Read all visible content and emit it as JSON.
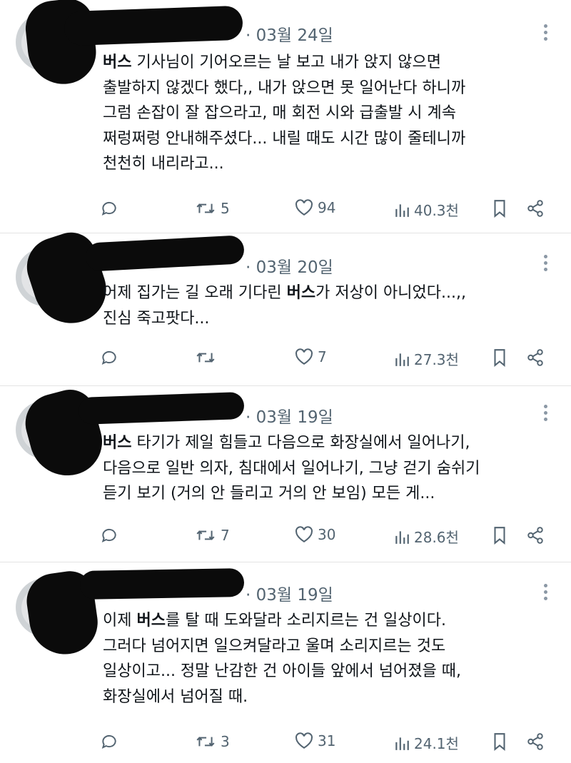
{
  "tweets": [
    {
      "date": "· 03월 24일",
      "line1_hl": "버스",
      "line1": " 기사님이 기어오르는 날 보고 내가 앉지 않으면",
      "line2": "출발하지 않겠다 했다,, 내가 앉으면 못 일어난다 하니까",
      "line3": "그럼 손잡이 잘 잡으라고, 매 회전 시와 급출발 시 계속",
      "line4": "쩌렁쩌렁 안내해주셨다... 내릴 때도 시간 많이 줄테니까",
      "line5": "천천히 내리라고...",
      "retweets": "5",
      "likes": "94",
      "views": "40.3천"
    },
    {
      "date": "· 03월 20일",
      "line1_pre": "어제 집가는 길 오래 기다린 ",
      "line1_hl": "버스",
      "line1_post": "가 저상이 아니었다...,,",
      "line2": "진심 죽고팟다...",
      "retweets": "",
      "likes": "7",
      "views": "27.3천"
    },
    {
      "date": "· 03월 19일",
      "line1_hl": "버스",
      "line1": " 타기가 제일 힘들고 다음으로 화장실에서 일어나기,",
      "line2": "다음으로 일반 의자, 침대에서 일어나기, 그냥 걷기 숨쉬기",
      "line3": "듣기 보기 (거의 안 들리고 거의 안 보임) 모든 게...",
      "retweets": "7",
      "likes": "30",
      "views": "28.6천"
    },
    {
      "date": "· 03월 19일",
      "line1_pre": "이제 ",
      "line1_hl": "버스",
      "line1_post": "를 탈 때 도와달라 소리지르는 건 일상이다.",
      "line2": "그러다 넘어지면 일으켜달라고 울며 소리지르는 것도",
      "line3": "일상이고... 정말 난감한 건 아이들 앞에서 넘어졌을 때,",
      "line4": "화장실에서 넘어질 때.",
      "retweets": "3",
      "likes": "31",
      "views": "24.1천"
    }
  ],
  "icons": {
    "reply": "reply-icon",
    "retweet": "retweet-icon",
    "like": "heart-icon",
    "views": "views-icon",
    "bookmark": "bookmark-icon",
    "share": "share-icon",
    "more": "more-icon"
  },
  "colors": {
    "icon": "#536471",
    "text": "#0f1419",
    "divider": "#e4e4e4",
    "redaction": "#0b0b0b"
  }
}
